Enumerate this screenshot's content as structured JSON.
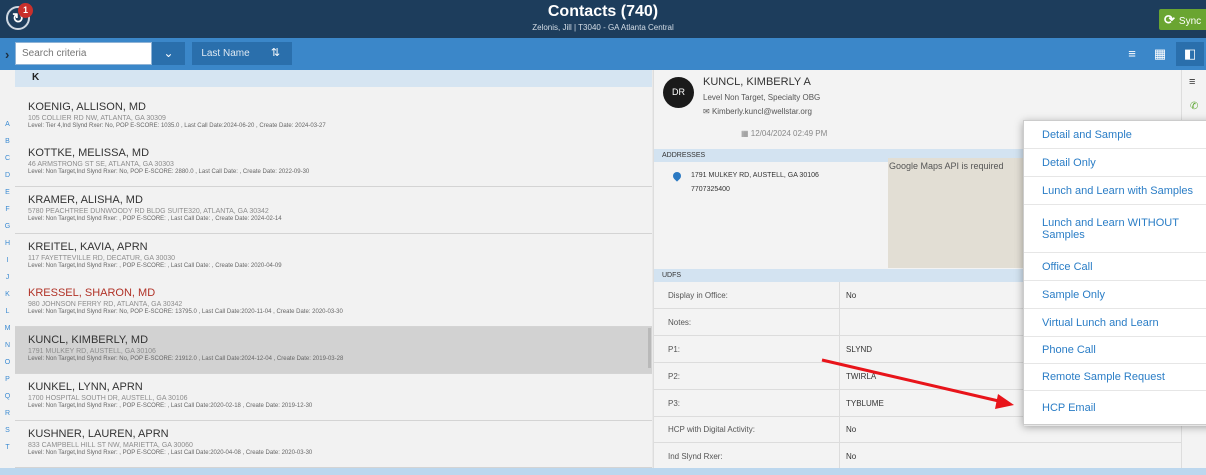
{
  "header": {
    "notification_count": "1",
    "title": "Contacts (740)",
    "subtitle": "Zelonis, Jill | T3040 - GA Atlanta Central",
    "sync_label": "Sync"
  },
  "toolbar": {
    "search_placeholder": "Search criteria",
    "sort_field": "Last Name"
  },
  "alphabet": [
    "A",
    "B",
    "C",
    "D",
    "E",
    "F",
    "G",
    "H",
    "I",
    "J",
    "K",
    "L",
    "M",
    "N",
    "O",
    "P",
    "Q",
    "R",
    "S",
    "T"
  ],
  "list": {
    "section_letter": "K",
    "contacts": [
      {
        "name": "KOENIG, ALLISON, MD",
        "address": "105 COLLIER RD NW, ATLANTA, GA 30309",
        "meta": "Level: Tier 4,Ind Slynd Rxer: No, POP E-SCORE: 1035.0 , Last Call Date:2024-06-20 , Create Date: 2024-03-27"
      },
      {
        "name": "KOTTKE, MELISSA, MD",
        "address": "46 ARMSTRONG ST SE, ATLANTA, GA 30303",
        "meta": "Level: Non Target,Ind Slynd Rxer: No, POP E-SCORE: 2880.0 , Last Call Date: , Create Date: 2022-09-30"
      },
      {
        "name": "KRAMER, ALISHA, MD",
        "address": "5780 PEACHTREE DUNWOODY RD BLDG SUITE320, ATLANTA, GA 30342",
        "meta": "Level: Non Target,Ind Slynd Rxer: , POP E-SCORE: , Last Call Date: , Create Date: 2024-02-14"
      },
      {
        "name": "KREITEL, KAVIA, APRN",
        "address": "117 FAYETTEVILLE RD, DECATUR, GA 30030",
        "meta": "Level: Non Target,Ind Slynd Rxer: , POP E-SCORE: , Last Call Date: , Create Date: 2020-04-09"
      },
      {
        "name": "KRESSEL, SHARON, MD",
        "address": "980 JOHNSON FERRY RD, ATLANTA, GA 30342",
        "meta": "Level: Non Target,Ind Slynd Rxer: No, POP E-SCORE: 13795.0 , Last Call Date:2020-11-04 , Create Date: 2020-03-30"
      },
      {
        "name": "KUNCL, KIMBERLY, MD",
        "address": "1791 MULKEY RD, AUSTELL, GA 30106",
        "meta": "Level: Non Target,Ind Slynd Rxer: No, POP E-SCORE: 21912.0 , Last Call Date:2024-12-04 , Create Date: 2019-03-28"
      },
      {
        "name": "KUNKEL, LYNN, APRN",
        "address": "1700 HOSPITAL SOUTH DR, AUSTELL, GA 30106",
        "meta": "Level: Non Target,Ind Slynd Rxer: , POP E-SCORE: , Last Call Date:2020-02-18 , Create Date: 2019-12-30"
      },
      {
        "name": "KUSHNER, LAUREN, APRN",
        "address": "833 CAMPBELL HILL ST NW, MARIETTA, GA 30060",
        "meta": "Level: Non Target,Ind Slynd Rxer: , POP E-SCORE: , Last Call Date:2020-04-08 , Create Date: 2020-03-30"
      }
    ]
  },
  "detail": {
    "name": "KUNCL, KIMBERLY A",
    "level": "Level Non Target, Specialty OBG",
    "email": "Kimberly.kuncl@wellstar.org",
    "date": "12/04/2024 02:49 PM",
    "addresses_header": "ADDRESSES",
    "address_line1": "1791 MULKEY RD, AUSTELL, GA 30106",
    "address_line2": "7707325400",
    "map_note": "Google Maps API is required",
    "udfs_header": "UDFS",
    "udfs": [
      {
        "label": "Display in Office:",
        "value": "No"
      },
      {
        "label": "Notes:",
        "value": ""
      },
      {
        "label": "P1:",
        "value": "SLYND"
      },
      {
        "label": "P2:",
        "value": "TWIRLA"
      },
      {
        "label": "P3:",
        "value": "TYBLUME"
      },
      {
        "label": "HCP with Digital Activity:",
        "value": "No"
      },
      {
        "label": "Ind Slynd Rxer:",
        "value": "No"
      }
    ]
  },
  "call_menu": {
    "items": [
      "Detail and Sample",
      "Detail Only",
      "Lunch and Learn with Samples",
      "Lunch and Learn WITHOUT Samples",
      "Office Call",
      "Sample Only",
      "Virtual Lunch and Learn",
      "Phone Call",
      "Remote Sample Request",
      "HCP Email"
    ]
  },
  "colors": {
    "header": "#1d3d5c",
    "toolbar": "#3b87c9",
    "sync": "#6aa531",
    "link": "#2a7dc6",
    "annotation_arrow": "#e8141a",
    "highlight_name": "#b13227"
  },
  "icons": [
    "logo-icon",
    "filter-icon",
    "chevron-down-icon",
    "sort-icon",
    "list-view-icon",
    "grid-view-icon",
    "split-view-icon",
    "sync-icon",
    "avatar-icon",
    "mail-icon",
    "calendar-icon",
    "map-pin-icon",
    "menu-icon",
    "phone-icon"
  ]
}
